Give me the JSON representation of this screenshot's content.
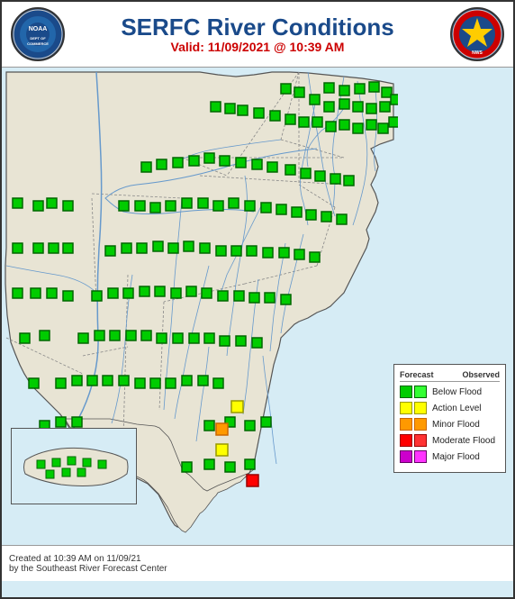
{
  "header": {
    "title": "SERFC River Conditions",
    "valid_line": "Valid: 11/09/2021 @ 10:39 AM",
    "logo_left_text": "NOAA",
    "logo_right_text": "NWS"
  },
  "footer": {
    "line1": "Created at 10:39 AM on 11/09/21",
    "line2": "by the Southeast River Forecast Center"
  },
  "legend": {
    "title_forecast": "Forecast",
    "title_observed": "Observed",
    "items": [
      {
        "label": "Below Flood",
        "color_forecast": "#00cc00",
        "color_obs": "#33ff33",
        "border": "#006600"
      },
      {
        "label": "Action Level",
        "color_forecast": "#ffff00",
        "color_obs": "#ffff00",
        "border": "#999900"
      },
      {
        "label": "Minor Flood",
        "color_forecast": "#ff9900",
        "color_obs": "#ff9900",
        "border": "#cc6600"
      },
      {
        "label": "Moderate Flood",
        "color_forecast": "#ff0000",
        "color_obs": "#ff3333",
        "border": "#990000"
      },
      {
        "label": "Major Flood",
        "color_forecast": "#cc00cc",
        "color_obs": "#ff33ff",
        "border": "#660066"
      }
    ]
  },
  "map": {
    "background_color": "#d6ecf5",
    "land_color": "#f0ede0",
    "border_color": "#555555",
    "river_color": "#6699cc"
  }
}
